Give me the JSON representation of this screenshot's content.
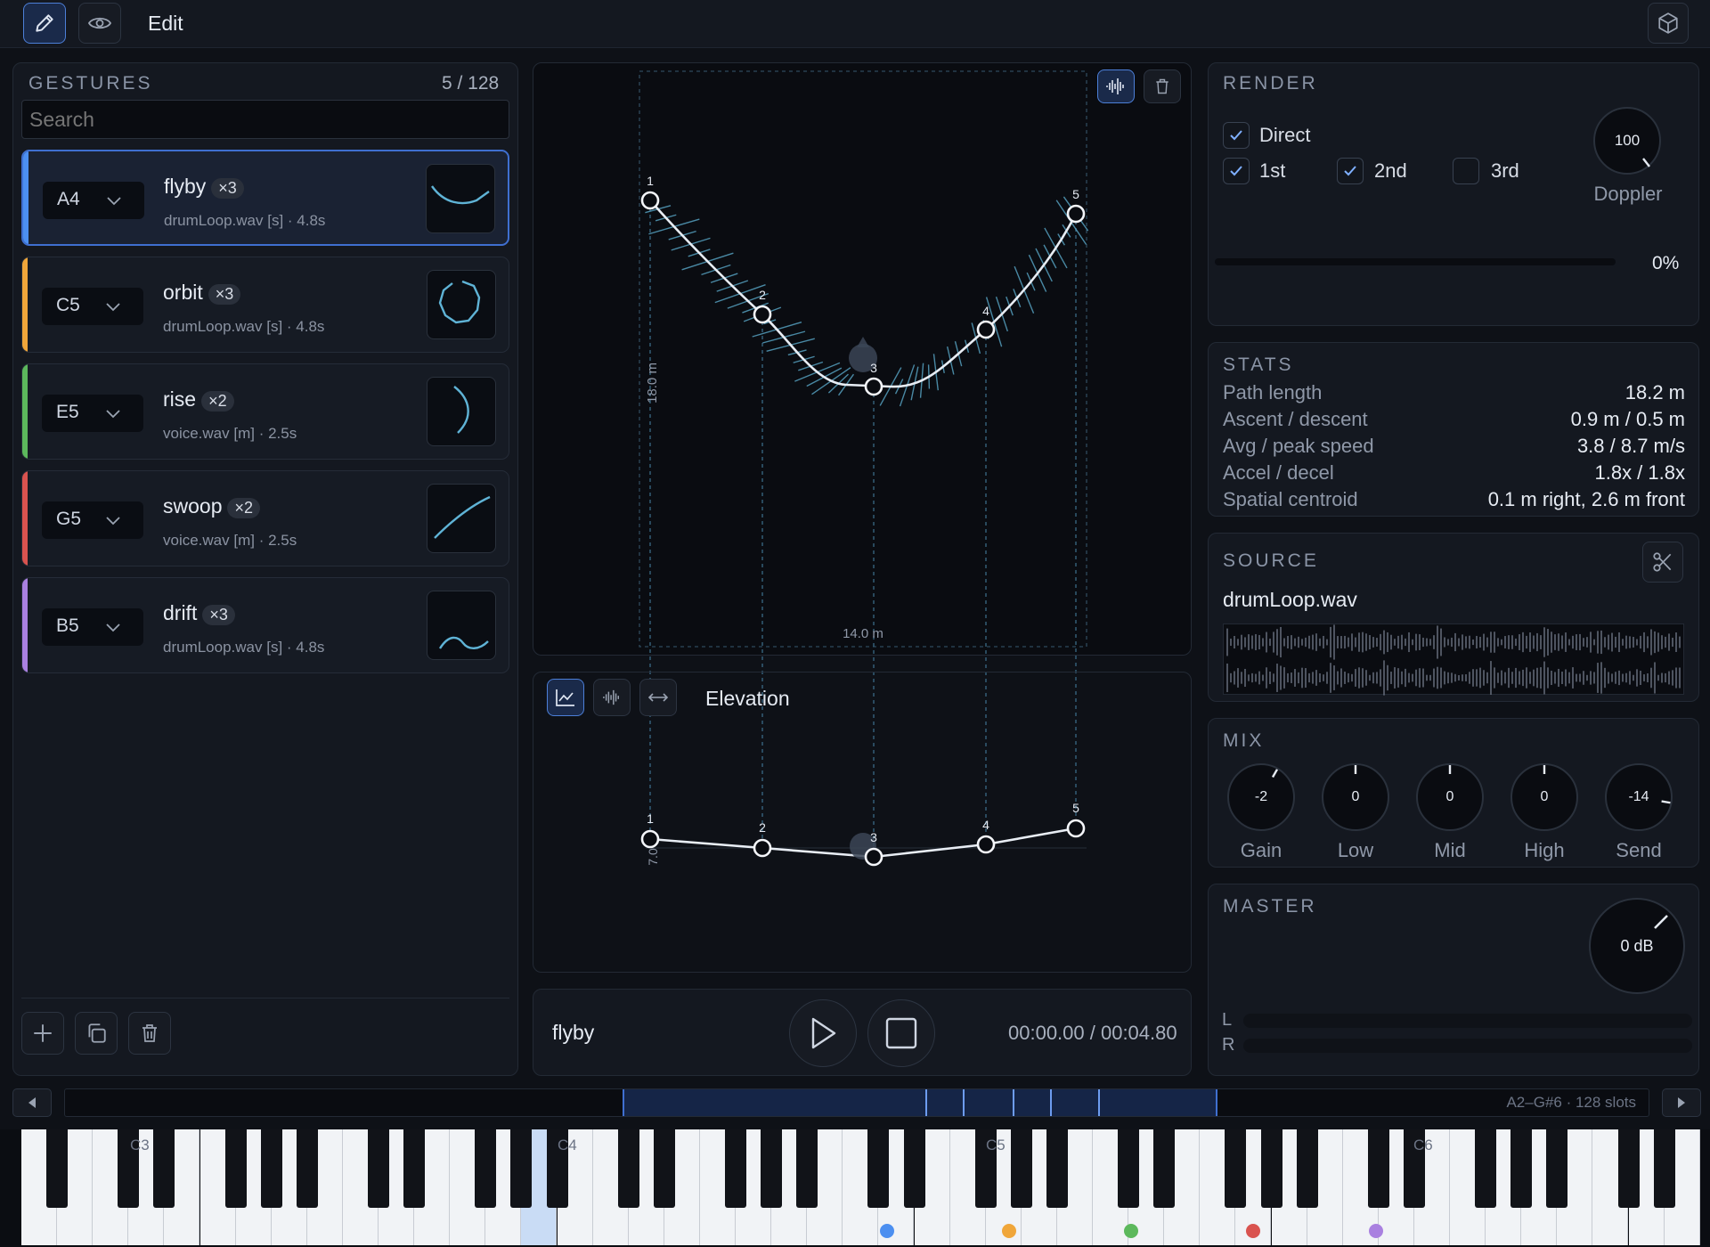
{
  "topbar": {
    "mode_label": "Edit"
  },
  "gestures": {
    "header": "GESTURES",
    "count": "5 / 128",
    "search_placeholder": "Search",
    "items": [
      {
        "note": "A4",
        "name": "flyby",
        "count": "×3",
        "sub": "drumLoop.wav [s] · 4.8s",
        "color": "#4c8ff0",
        "selected": true
      },
      {
        "note": "C5",
        "name": "orbit",
        "count": "×3",
        "sub": "drumLoop.wav [s] · 4.8s",
        "color": "#f0a63a"
      },
      {
        "note": "E5",
        "name": "rise",
        "count": "×2",
        "sub": "voice.wav [m] · 2.5s",
        "color": "#5cb85c"
      },
      {
        "note": "G5",
        "name": "swoop",
        "count": "×2",
        "sub": "voice.wav [m] · 2.5s",
        "color": "#d9534f"
      },
      {
        "note": "B5",
        "name": "drift",
        "count": "×3",
        "sub": "drumLoop.wav [s] · 4.8s",
        "color": "#a980e0"
      }
    ]
  },
  "path_view": {
    "height_label": "18.0 m",
    "width_label": "14.0 m",
    "points": [
      "1",
      "2",
      "3",
      "4",
      "5"
    ]
  },
  "elevation": {
    "title": "Elevation",
    "axis_label": "7.0",
    "points": [
      "1",
      "2",
      "3",
      "4",
      "5"
    ]
  },
  "transport": {
    "gesture": "flyby",
    "time": "00:00.00 / 00:04.80"
  },
  "render": {
    "header": "RENDER",
    "direct": "Direct",
    "first": "1st",
    "second": "2nd",
    "third": "3rd",
    "doppler_value": "100",
    "doppler_label": "Doppler",
    "progress": "0%",
    "progress_value": 0
  },
  "stats": {
    "header": "STATS",
    "rows": [
      {
        "label": "Path length",
        "value": "18.2 m"
      },
      {
        "label": "Ascent / descent",
        "value": "0.9 m / 0.5 m"
      },
      {
        "label": "Avg / peak speed",
        "value": "3.8 / 8.7 m/s"
      },
      {
        "label": "Accel / decel",
        "value": "1.8x / 1.8x"
      },
      {
        "label": "Spatial centroid",
        "value": "0.1 m right, 2.6 m front"
      }
    ]
  },
  "source": {
    "header": "SOURCE",
    "file": "drumLoop.wav"
  },
  "mix": {
    "header": "MIX",
    "knobs": [
      {
        "value": "-2",
        "label": "Gain"
      },
      {
        "value": "0",
        "label": "Low"
      },
      {
        "value": "0",
        "label": "Mid"
      },
      {
        "value": "0",
        "label": "High"
      },
      {
        "value": "-14",
        "label": "Send"
      }
    ]
  },
  "master": {
    "header": "MASTER",
    "value": "0 dB",
    "left": "L",
    "right": "R"
  },
  "keyboard": {
    "range_label": "A2–G#6 · 128 slots",
    "octaves": [
      "C3",
      "C4",
      "C5",
      "C6"
    ],
    "dot_colors": [
      "#4c8ff0",
      "#f0a63a",
      "#5cb85c",
      "#d9534f",
      "#a980e0"
    ]
  }
}
